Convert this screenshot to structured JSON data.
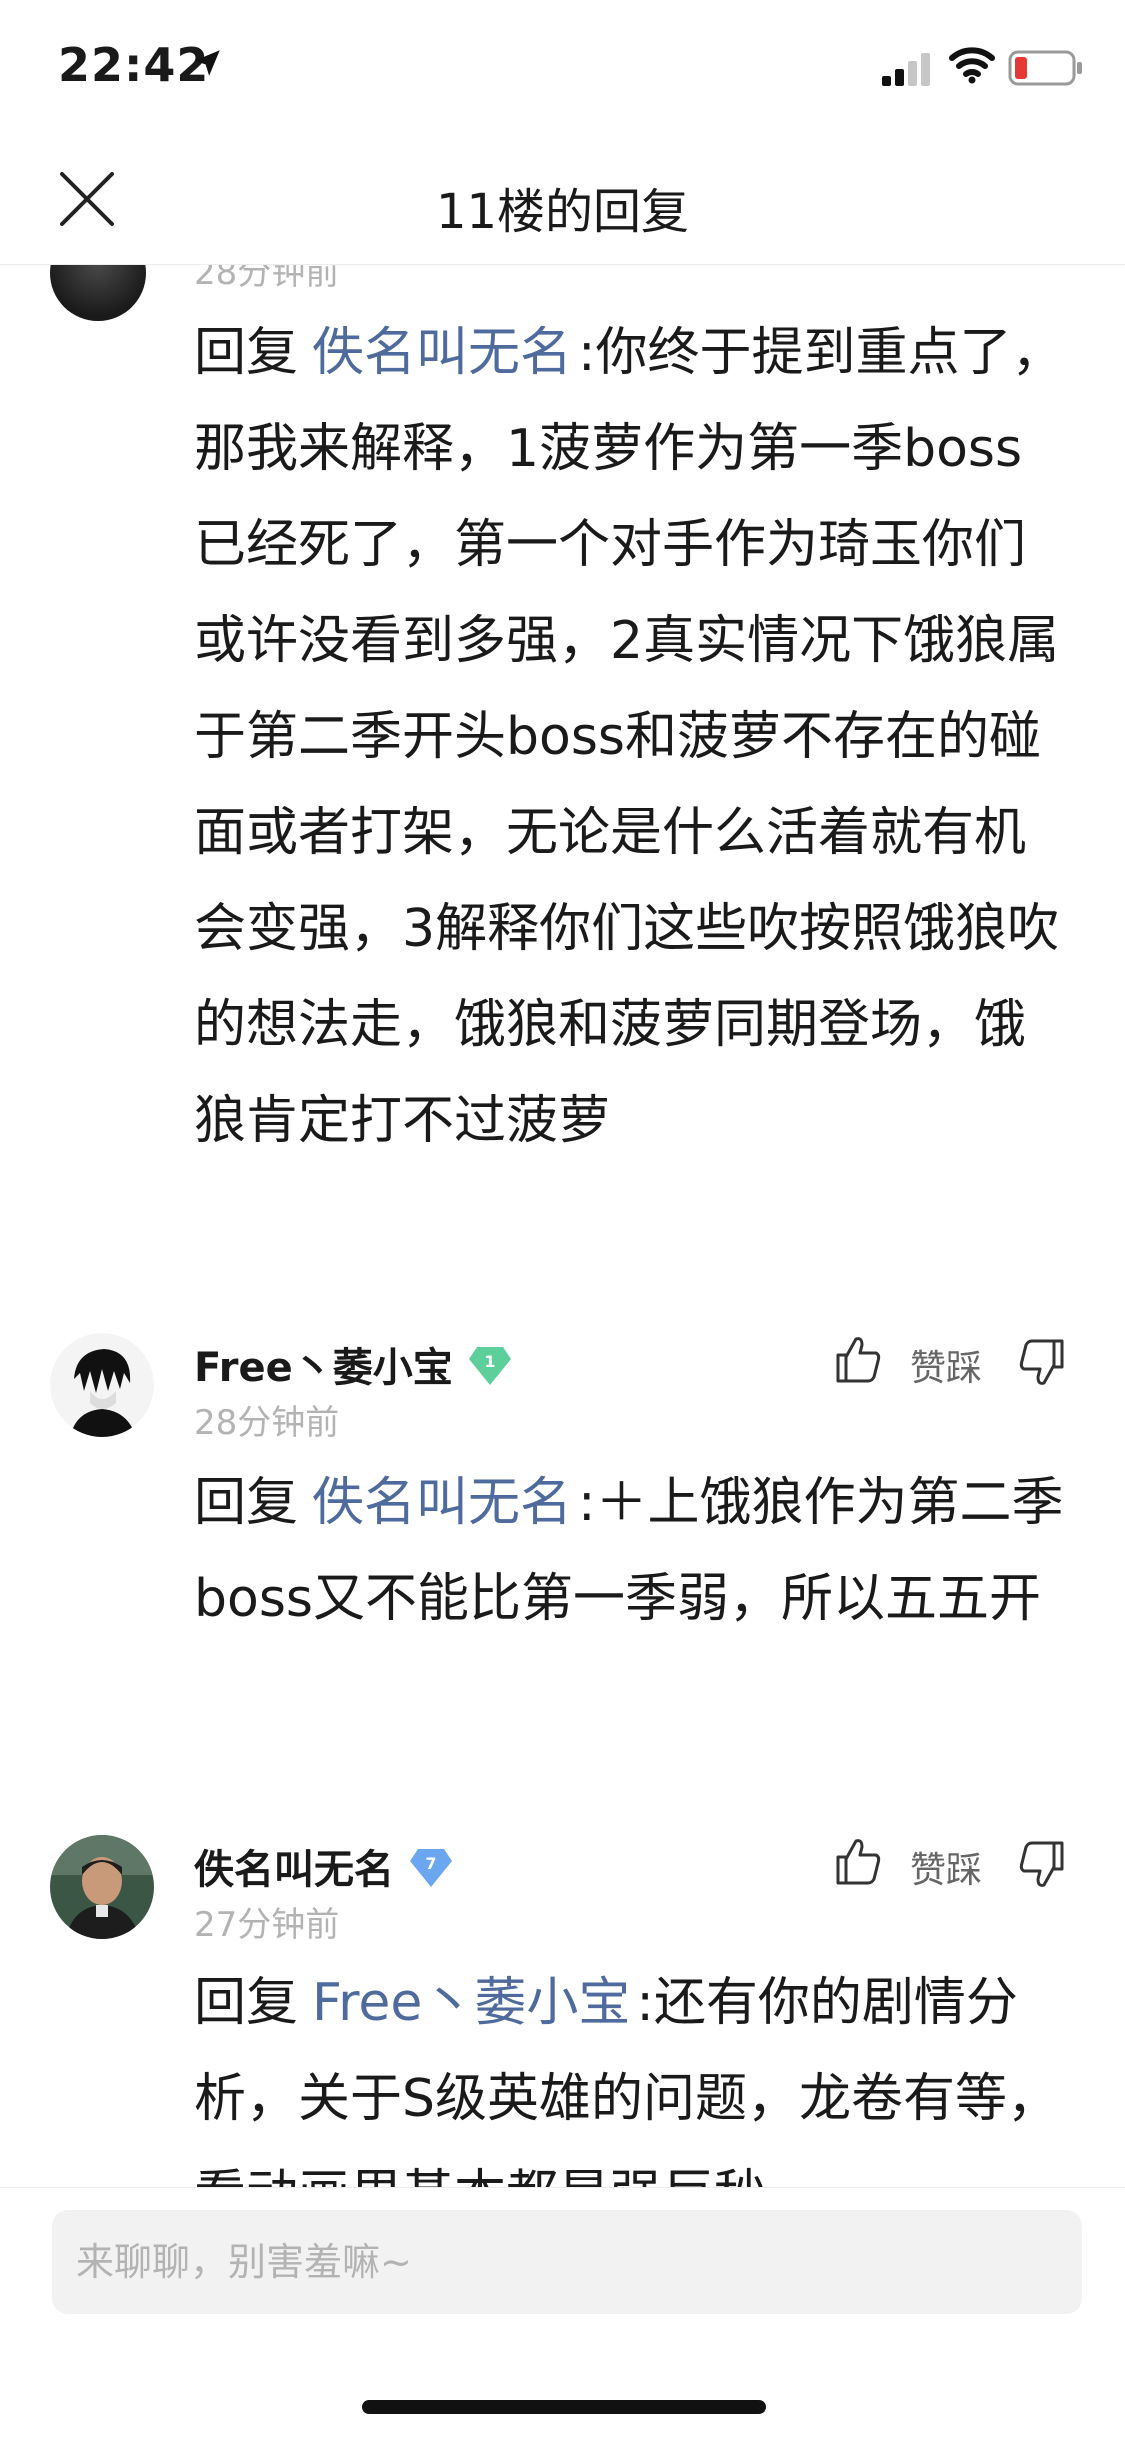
{
  "status_bar": {
    "time": "22:42"
  },
  "nav": {
    "title": "11楼的回复"
  },
  "partial": {
    "time": "28分钟前"
  },
  "reply_prefix": "回复",
  "replies": [
    {
      "target": "佚名叫无名",
      "body": ":你终于提到重点了，那我来解释，1菠萝作为第一季boss已经死了，第一个对手作为琦玉你们或许没看到多强，2真实情况下饿狼属于第二季开头boss和菠萝不存在的碰面或者打架，无论是什么活着就有机会变强，3解释你们这些吹按照饿狼吹的想法走，饿狼和菠萝同期登场，饿狼肯定打不过菠萝"
    },
    {
      "user": "Free丶萎小宝",
      "level": "1",
      "time": "28分钟前",
      "vote_label": "赞踩",
      "target": "佚名叫无名",
      "body": ":＋上饿狼作为第二季boss又不能比第一季弱，所以五五开"
    },
    {
      "user": "佚名叫无名",
      "level": "7",
      "time": "27分钟前",
      "vote_label": "赞踩",
      "target": "Free丶萎小宝",
      "body": ":还有你的剧情分析，关于S级英雄的问题，龙卷有等，看动画里基本都是强巨秒"
    }
  ],
  "colors": {
    "link": "#4f6a9c",
    "badge_green": "#5ccf9a",
    "badge_blue": "#6aa7f0",
    "battery_low": "#e53935"
  },
  "input": {
    "placeholder": "来聊聊，别害羞嘛~"
  }
}
